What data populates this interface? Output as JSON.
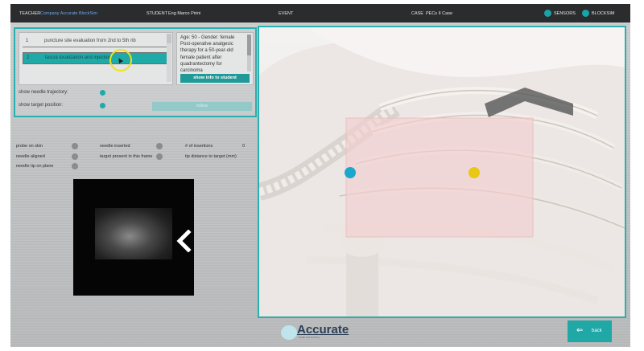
{
  "topbar": {
    "teacher_label": "TEACHER",
    "teacher_value": "Company Accurate BlockSim",
    "student_label": "STUDENT",
    "student_value": "Eng Marco Pirini",
    "event_label": "EVENT",
    "case_label": "CASE",
    "case_value": "PECs II Case",
    "sensors_label": "SENSORS",
    "blocksim_label": "BLOCKSIM",
    "accent": "#1aa3a8"
  },
  "steps": [
    {
      "number": "1",
      "label": "puncture site evaluation from 2nd to 5th rib"
    },
    {
      "number": "2",
      "label": "fascia localization and injection"
    }
  ],
  "patient_info": {
    "text": "Age: 50 - Gender: female Post-operative analgesic therapy for a 50-year-old female patient after quadrantectomy for carcinoma",
    "show_button": "show info to student"
  },
  "options": {
    "needle_trajectory": "show needle trajectory:",
    "target_position": "show target position:",
    "follow_button": "follow"
  },
  "stats": {
    "probe_on_skin": "probe on skin",
    "needle_aligned": "needle aligned",
    "needle_tip_on_plane": "needle tip on plane",
    "needle_inserted": "needle inserted",
    "target_present": "target present in this frame",
    "num_insertions_label": "# of insertions",
    "num_insertions_value": "0",
    "tip_distance_label": "tip distance to target (mm)"
  },
  "footer": {
    "brand": "Accurate",
    "brand_sub": "health and learning",
    "back_label": "back"
  }
}
